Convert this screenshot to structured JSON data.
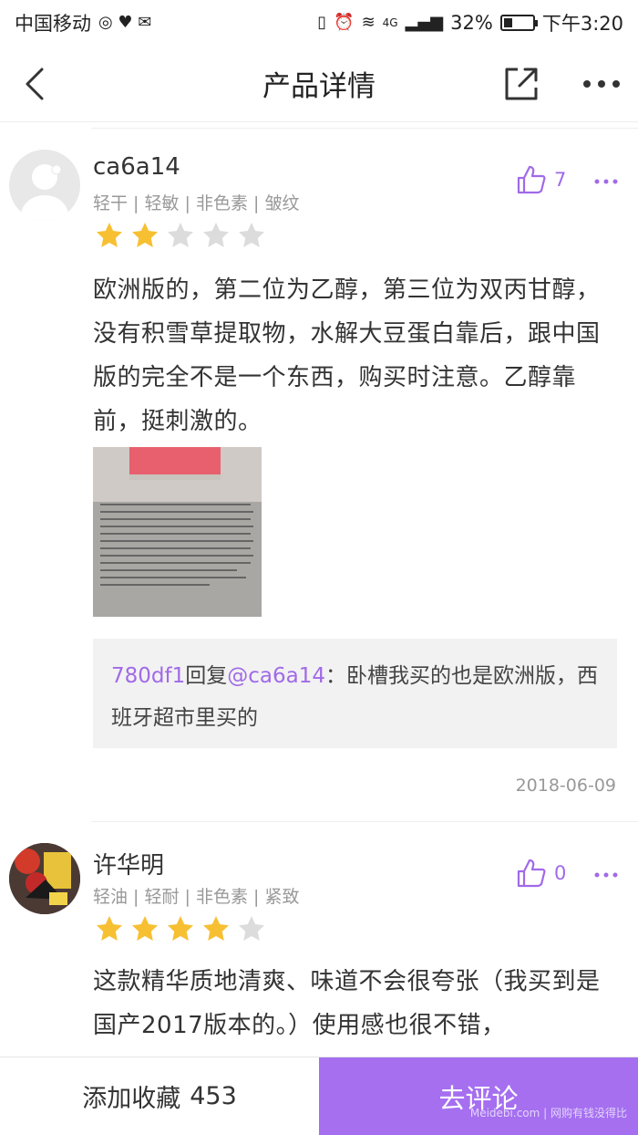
{
  "status_bar": {
    "carrier": "中国移动",
    "network": "4G",
    "battery_text": "32%",
    "battery_level": 0.32,
    "time": "下午3:20"
  },
  "nav": {
    "title": "产品详情",
    "icons": [
      "back-arrow-icon",
      "share-icon",
      "more-icon"
    ]
  },
  "reviews": [
    {
      "username": "ca6a14",
      "tags": "轻干 | 轻敏 | 非色素 | 皱纹",
      "rating": 2,
      "likes": "7",
      "content": "欧洲版的，第二位为乙醇，第三位为双丙甘醇，没有积雪草提取物，水解大豆蛋白靠后，跟中国版的完全不是一个东西，购买时注意。乙醇靠前，挺刺激的。",
      "reply": {
        "user": "780df1",
        "verb": "回复",
        "target": "@ca6a14",
        "text": "：卧槽我买的也是欧洲版，西班牙超市里买的"
      },
      "date": "2018-06-09"
    },
    {
      "username": "许华明",
      "tags": "轻油 | 轻耐 | 非色素 | 紧致",
      "rating": 4,
      "likes": "0",
      "content": "这款精华质地清爽、味道不会很夸张（我买到是国产2017版本的。）使用感也很不错，"
    }
  ],
  "bottom_bar": {
    "favorite_label": "添加收藏",
    "favorite_count": "453",
    "comment_label": "去评论",
    "watermark": "Meidebi.com | 网购有钱没得比"
  },
  "colors": {
    "accent": "#a56ff0",
    "star_active": "#f7c033",
    "star_inactive": "#dcdcdc"
  }
}
